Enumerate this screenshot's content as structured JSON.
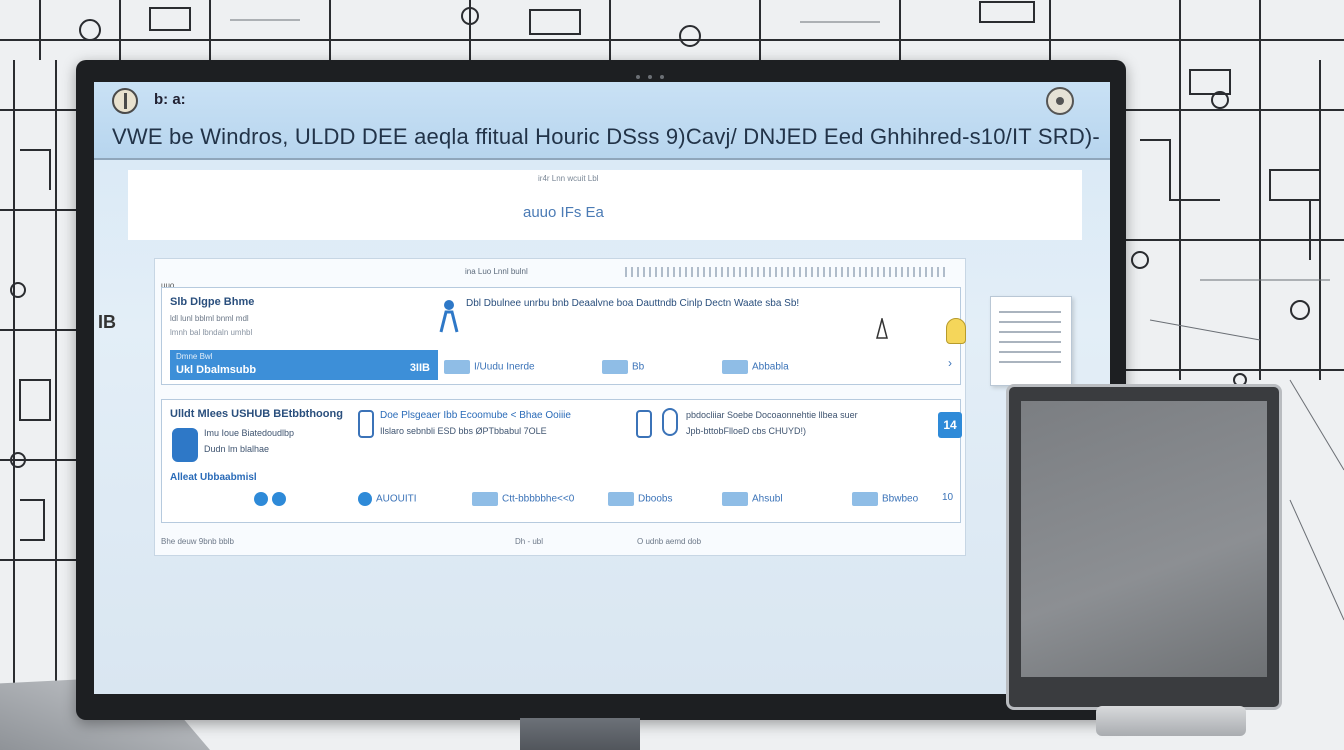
{
  "window": {
    "small_label": "b: a:",
    "title": "VWE be Windros, ULDD DEE aeqla ffitual Houric DSss 9)Cavj/ DNJED Eed Ghhihred-s10/IT SRD)-"
  },
  "header": {
    "tiny_text": "ir4r Lnn wcuit Lbl",
    "label": "auuo IFs Ea"
  },
  "toolbar": {
    "text": "ina Luo Lnnl bulnl"
  },
  "side_label": "IB",
  "section_a": {
    "tag": "uuo",
    "title": "Slb Dlgpe Bhme",
    "sub1": "ldl lunl bblml bnml mdl",
    "sub2": "lmnh bal lbndaln umhbl",
    "desc": "Dbl Dbulnee unrbu bnb Deaalvne boa Dauttndb Cinlp Dectn Waate sba Sb!",
    "select_bar": {
      "top": "Dmne Bwl",
      "label": "Ukl Dbalmsubb",
      "number": "3IIB"
    },
    "row": [
      "I/Uudu Inerde",
      "Bb",
      "Abbabla"
    ]
  },
  "section_b": {
    "title": "Ulldt Mlees USHUB BEtbbthoong",
    "line1": "Imu Ioue Biatedoudlbp",
    "line2": "Dudn lm blalhae",
    "blue_label": "Alleat Ubbaabmisl",
    "mid1": "Doe Plsgeaer Ibb Ecoomube < Bhae Ooiiie",
    "mid2": "Ilslaro sebnbli ESD bbs ØPTbbabul 7OLE",
    "right1": "pbdocliiar Soebe Docoaonnehtie llbea suer",
    "right2": "Jpb-bttobFlloeD cbs CHUYD!)",
    "badge": "14",
    "row": [
      "AUOUITI",
      "Ctt-bbbbbhe<<0",
      "Dboobs",
      "Ahsubl",
      "Bbwbeo",
      "10"
    ]
  },
  "footer": {
    "left": "Bhe deuw 9bnb bblb",
    "middle": "Dh - ubl",
    "right": "O udnb aemd dob"
  },
  "colors": {
    "accent": "#3d8fd8",
    "screen_bg": "#d7e8f6",
    "bezel": "#1d1f22"
  }
}
